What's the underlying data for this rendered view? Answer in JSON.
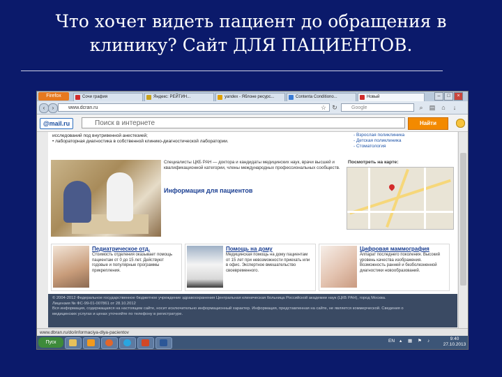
{
  "slide": {
    "title_line1": "Что хочет видеть пациент до обращения в",
    "title_line2": "клинику? Сайт ДЛЯ ПАЦИЕНТОВ."
  },
  "browser": {
    "firefox_button": "Firefox",
    "tabs": [
      {
        "label": "Сочи графия",
        "color": "#d12c2c",
        "active": false
      },
      {
        "label": "Яндекс: РЕЙТИН...",
        "color": "#c8a21e",
        "active": false
      },
      {
        "label": "yandex - Яблоне ресурс...",
        "color": "#e0a000",
        "active": false
      },
      {
        "label": "Contenta Conditiono...",
        "color": "#3a7bd5",
        "active": false
      },
      {
        "label": "Новый",
        "color": "#d12c2c",
        "active": true
      }
    ],
    "url": "www.dcran.ru",
    "search_placeholder": "Google",
    "status_url": "www.dbran.ru/do/informaciya-dlya-pacientov"
  },
  "mailru": {
    "logo": "@mail.ru",
    "search_placeholder": "Поиск в интернете",
    "find_button": "Найти"
  },
  "page": {
    "bullets": [
      "исследований под внутривенной анестезией;",
      "• лабораторная диагностика в собственной клинико-диагностической лаборатории."
    ],
    "right_links": [
      "- Взрослая поликлиника",
      "- Детская поликлиника",
      "- Стоматология"
    ],
    "intro_text": "Специалисты ЦКБ РАН — доктора и кандидаты медицинских наук, врачи высшей и квалификационной категории, члены международных профессиональных сообществ.",
    "info_heading": "Информация для пациентов",
    "map_label": "Посмотреть на карте:",
    "cards": [
      {
        "title": "Педиатрическое отд.",
        "text": "Стоимость отделения оказывает помощь пациентам от 0 до 15 лет. Действуют годовые и популярные программы прикрепления."
      },
      {
        "title": "Помощь на дому",
        "text": "Медицинская помощь на дому пациентам от 15 лет при невозможности приехать или в офис. Экспертное вмешательство своевременного."
      },
      {
        "title": "Цифровая маммография",
        "text": "Аппарат последнего поколения. Высокий уровень качества изображения. Возможность ранней и безболезненной диагностики новообразований."
      }
    ],
    "footer_lines": [
      "© 2004-2012 Федеральное государственное бюджетное учреждение здравоохранения Центральная клиническая больница Российской академии наук (ЦКБ РАН), город Москва.",
      "Лицензия № ФС-99-01-007861 от 28.10.2012",
      "Вся информация, содержащаяся на настоящем сайте, носит исключительно информационный характер. Информация, представленная на сайте, не является коммерческой. Сведения о",
      "медицинских услугах и ценах уточняйте по телефону в регистратуре."
    ]
  },
  "taskbar": {
    "start": "Пуск",
    "language": "EN",
    "time": "9:40",
    "date": "27.10.2013",
    "apps": [
      {
        "name": "folder",
        "color": "#e8c15a"
      },
      {
        "name": "media-player",
        "color": "#f29a1f"
      },
      {
        "name": "firefox",
        "color": "#e2662a"
      },
      {
        "name": "skype",
        "color": "#2aa6e0"
      },
      {
        "name": "powerpoint",
        "color": "#d24726"
      },
      {
        "name": "word",
        "color": "#2b5797"
      }
    ]
  },
  "colors": {
    "slide_background": "#0b1a6b",
    "link_blue": "#1b3f92",
    "mail_orange": "#f38a00",
    "footer": "#3a4a63"
  }
}
